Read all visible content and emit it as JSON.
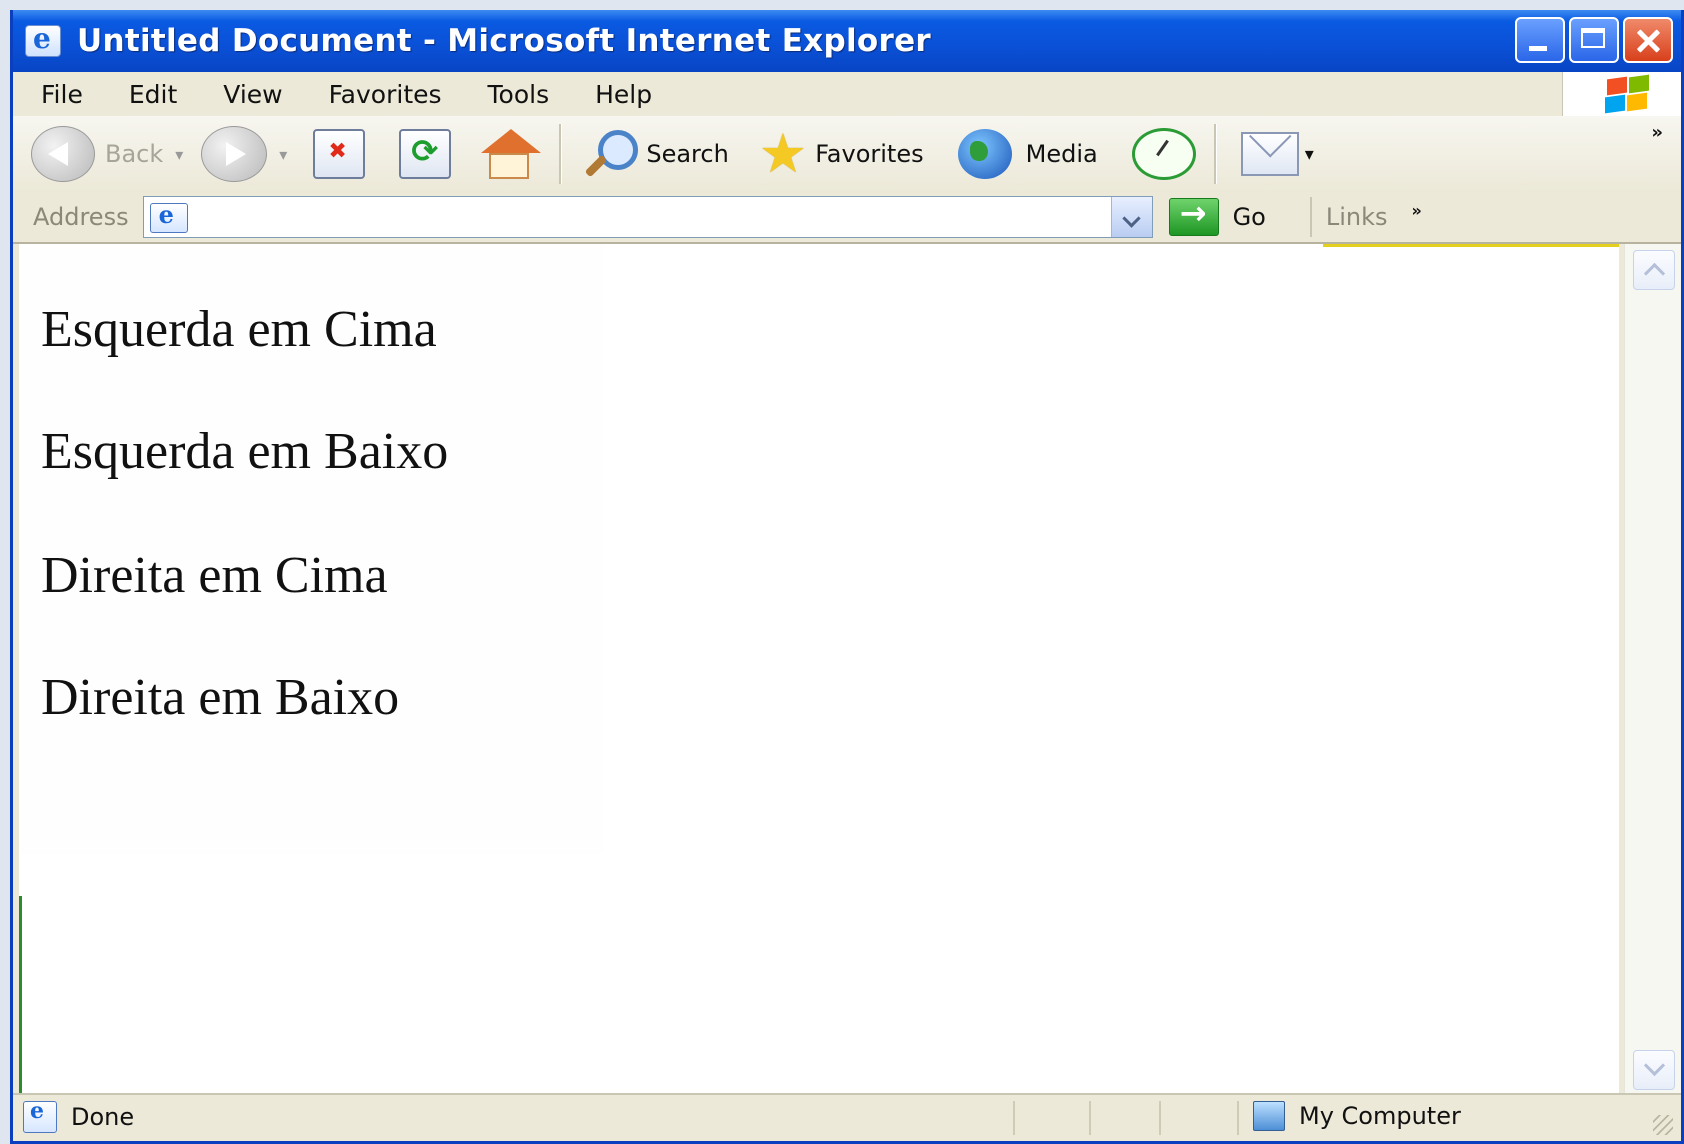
{
  "window": {
    "title": "Untitled Document - Microsoft Internet Explorer"
  },
  "menu": {
    "items": [
      {
        "label": "File"
      },
      {
        "label": "Edit"
      },
      {
        "label": "View"
      },
      {
        "label": "Favorites"
      },
      {
        "label": "Tools"
      },
      {
        "label": "Help"
      }
    ]
  },
  "toolbar": {
    "back_label": "Back",
    "search_label": "Search",
    "favorites_label": "Favorites",
    "media_label": "Media",
    "more": "»"
  },
  "address": {
    "label": "Address",
    "value": "",
    "go_label": "Go",
    "links_label": "Links",
    "links_more": "»"
  },
  "page": {
    "lines": [
      "Esquerda em Cima",
      "Esquerda em Baixo",
      "Direita em Cima",
      "Direita em Baixo"
    ],
    "colors": {
      "top_left_border": "#d9231b",
      "top_right_border": "#e3cf1d",
      "bottom_left_border": "#2a8c2e"
    }
  },
  "status": {
    "left_text": "Done",
    "zone_text": "My Computer"
  },
  "icons": [
    "ie-page-icon",
    "minimize-icon",
    "maximize-icon",
    "close-icon",
    "windows-logo-icon",
    "back-icon",
    "forward-icon",
    "stop-icon",
    "refresh-icon",
    "home-icon",
    "search-icon",
    "favorites-star-icon",
    "media-globe-icon",
    "history-icon",
    "mail-icon",
    "go-arrow-icon",
    "my-computer-icon"
  ]
}
